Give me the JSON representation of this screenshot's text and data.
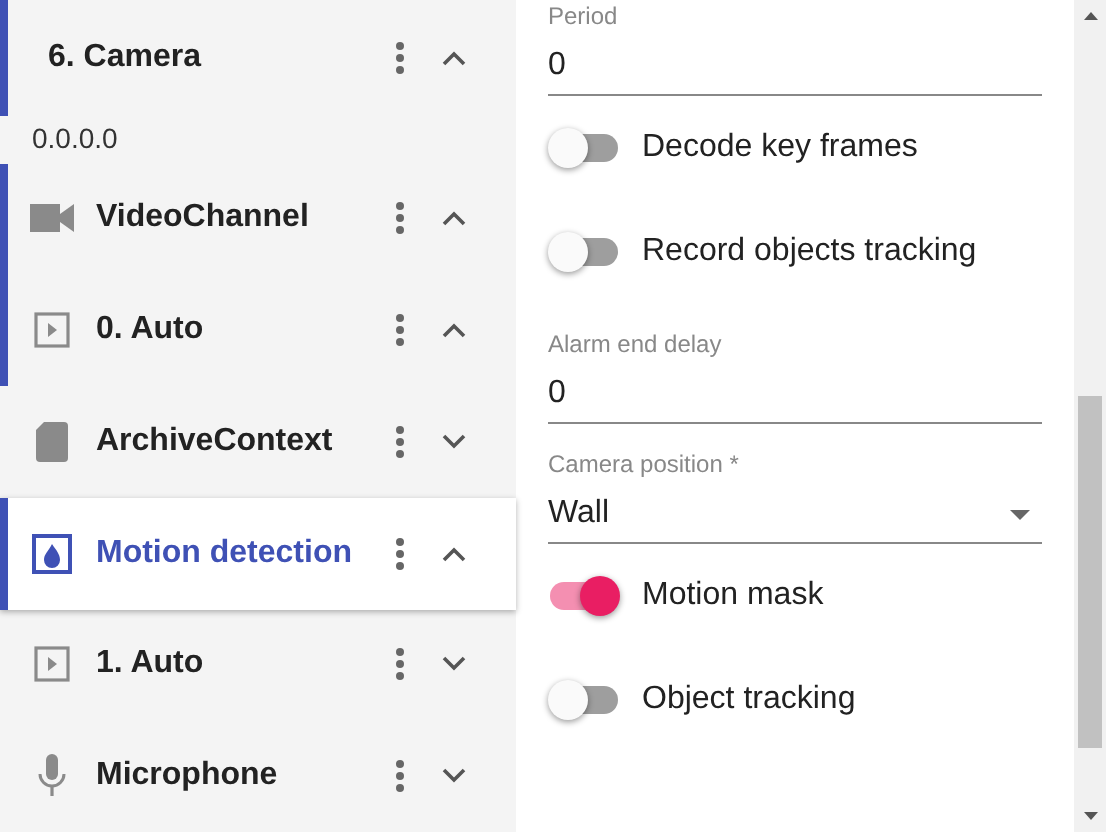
{
  "tree": [
    {
      "kind": "header",
      "label": "6. Camera",
      "expanded": true,
      "selected": false
    },
    {
      "kind": "address",
      "label": "0.0.0.0"
    },
    {
      "kind": "video",
      "label": "VideoChannel",
      "expanded": true,
      "selected": false
    },
    {
      "kind": "play",
      "label": "0. Auto",
      "expanded": true,
      "selected": false
    },
    {
      "kind": "archive",
      "label": "ArchiveContext",
      "expanded": false,
      "selected": false
    },
    {
      "kind": "motion",
      "label": "Motion detection",
      "expanded": true,
      "selected": true
    },
    {
      "kind": "play",
      "label": "1. Auto",
      "expanded": false,
      "selected": false
    },
    {
      "kind": "mic",
      "label": "Microphone",
      "expanded": false,
      "selected": false
    }
  ],
  "settings": [
    {
      "kind": "field",
      "label": "Period",
      "value": "0"
    },
    {
      "kind": "switch",
      "label": "Decode key frames",
      "on": false
    },
    {
      "kind": "switch",
      "label": "Record objects tracking",
      "on": false
    },
    {
      "kind": "field",
      "label": "Alarm end delay",
      "value": "0"
    },
    {
      "kind": "select",
      "label": "Camera position *",
      "value": "Wall"
    },
    {
      "kind": "switch",
      "label": "Motion mask",
      "on": true
    },
    {
      "kind": "switch",
      "label": "Object tracking",
      "on": false
    }
  ]
}
